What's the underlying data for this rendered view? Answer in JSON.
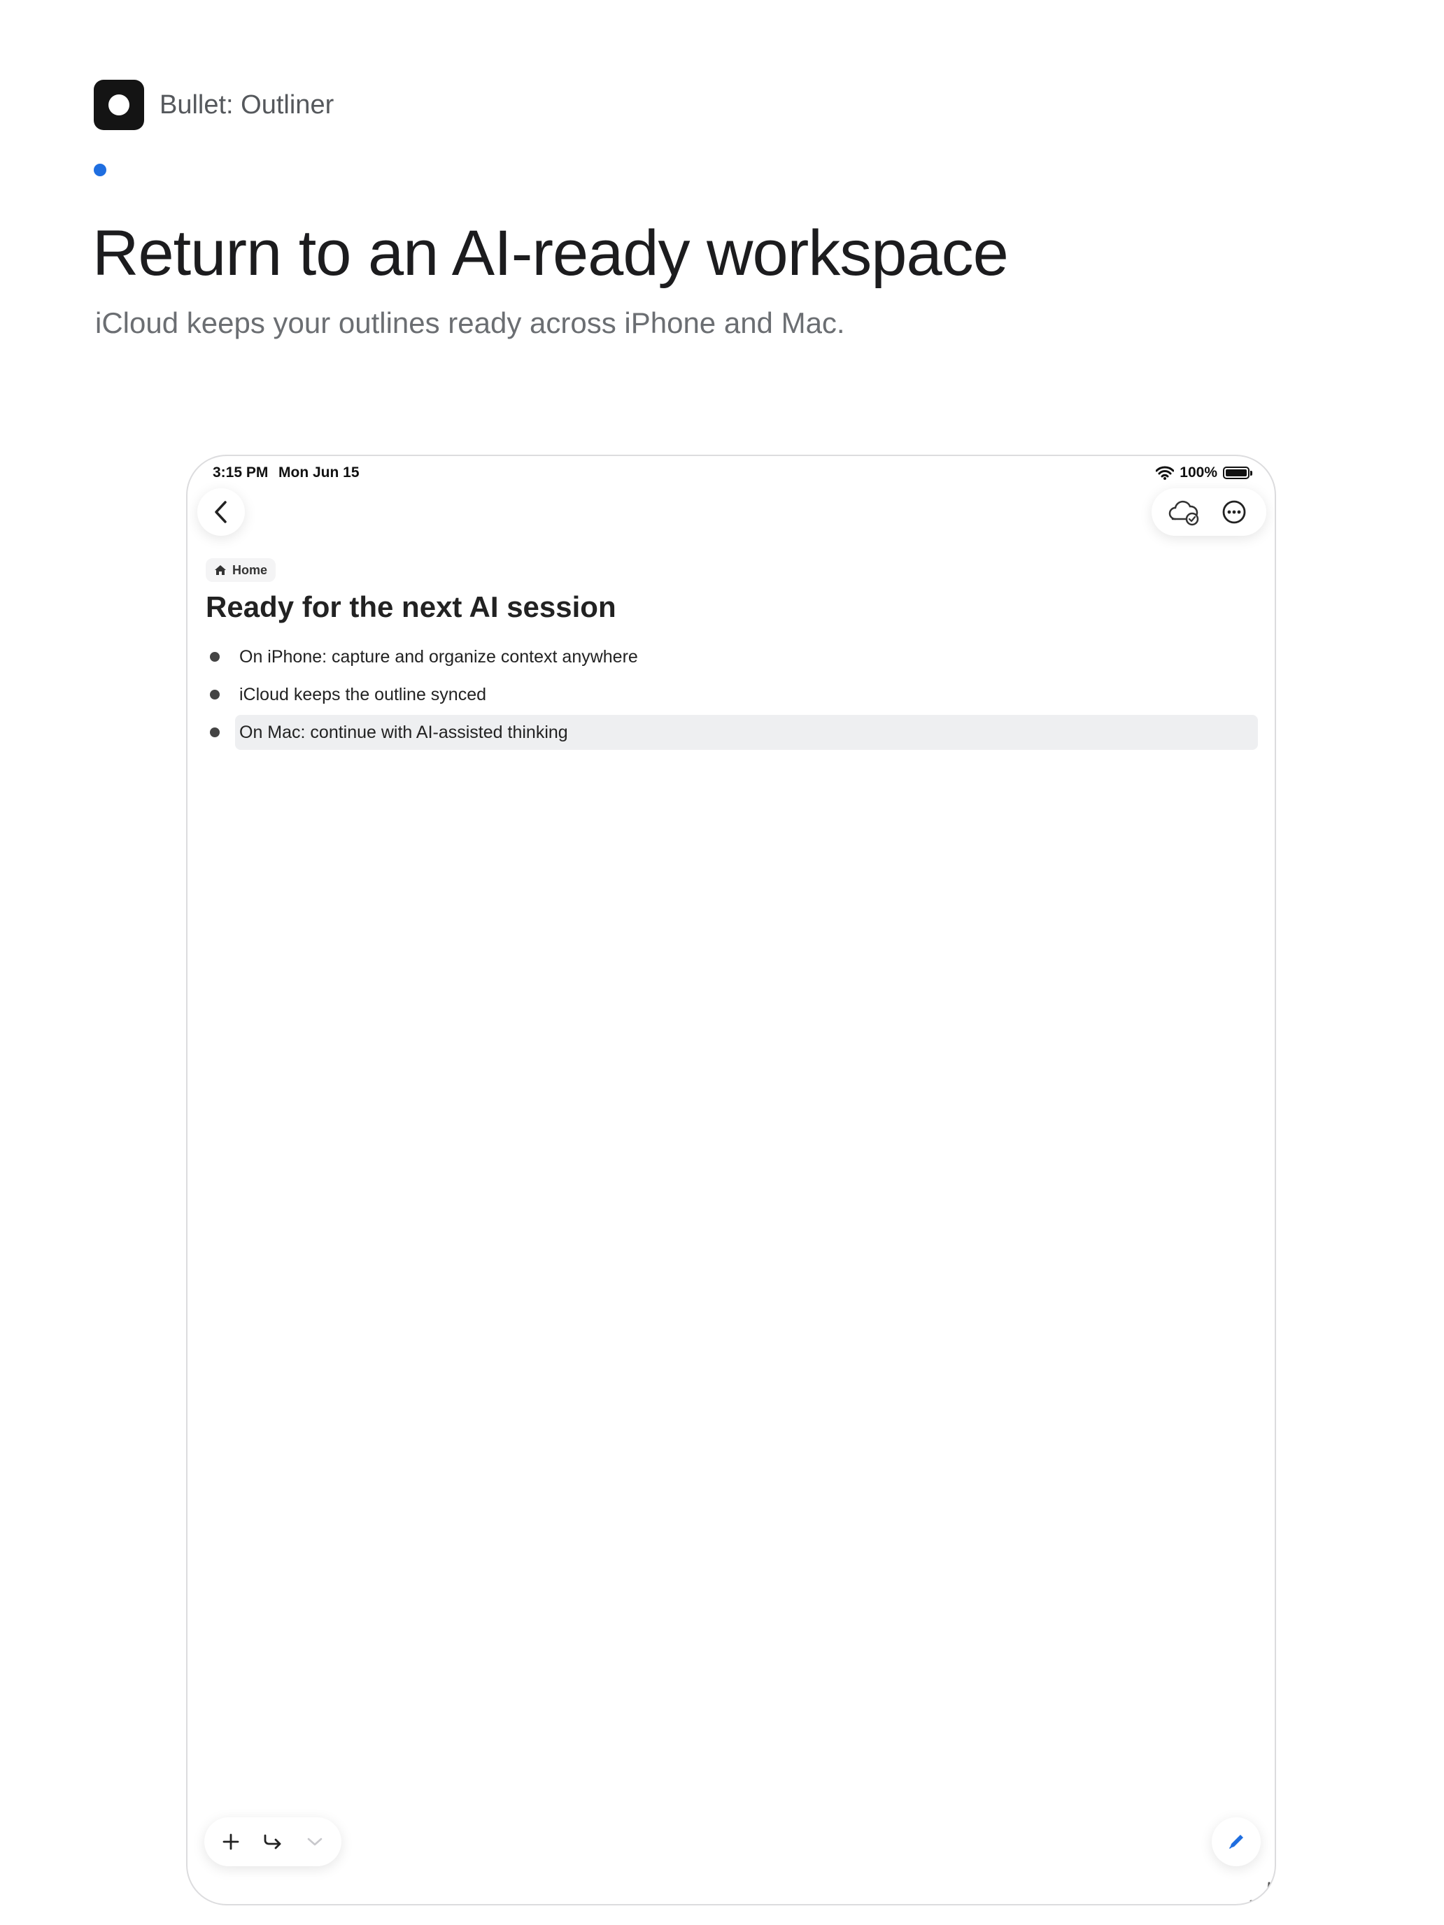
{
  "app": {
    "name": "Bullet: Outliner"
  },
  "hero": {
    "headline": "Return to an AI-ready workspace",
    "subheadline": "iCloud keeps your outlines ready across iPhone and Mac."
  },
  "device": {
    "status_bar": {
      "time": "3:15 PM",
      "date": "Mon Jun 15",
      "battery": "100%"
    },
    "breadcrumb": {
      "icon": "home-icon",
      "label": "Home"
    },
    "document": {
      "title": "Ready for the next AI session",
      "items": [
        {
          "text": "On iPhone: capture and organize context anywhere",
          "selected": false
        },
        {
          "text": "iCloud keeps the outline synced",
          "selected": false
        },
        {
          "text": "On Mac: continue with AI-assisted thinking",
          "selected": true
        }
      ]
    },
    "toolbar": {
      "icons": [
        "plus-icon",
        "indent-icon",
        "chevron-down-icon"
      ]
    },
    "top_actions": {
      "icons": [
        "cloud-sync-icon",
        "more-icon"
      ]
    }
  },
  "colors": {
    "accent": "#1f6ee0",
    "brand_icon": "#141414",
    "selected_row": "#eeeff1"
  }
}
